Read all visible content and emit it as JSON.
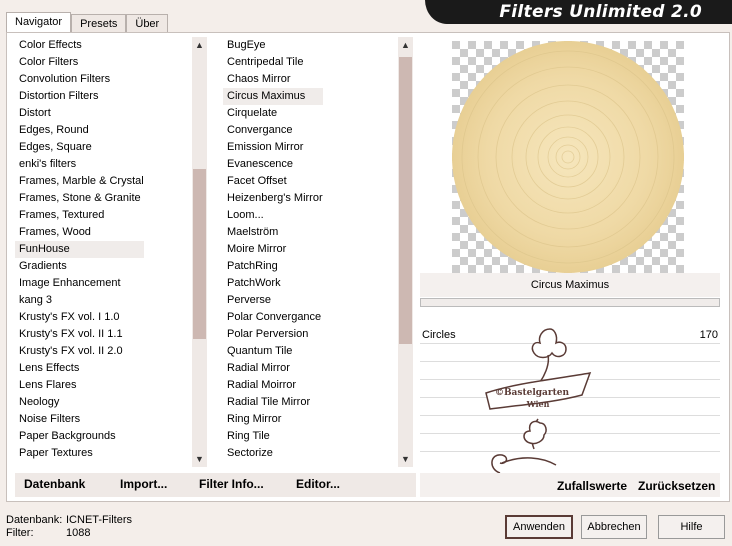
{
  "tabs": [
    "Navigator",
    "Presets",
    "Über"
  ],
  "brand": "Filters Unlimited 2.0",
  "categories": [
    "Color Effects",
    "Color Filters",
    "Convolution Filters",
    "Distortion Filters",
    "Distort",
    "Edges, Round",
    "Edges, Square",
    "enki's filters",
    "Frames, Marble & Crystal",
    "Frames, Stone & Granite",
    "Frames, Textured",
    "Frames, Wood",
    "FunHouse",
    "Gradients",
    "Image Enhancement",
    "kang 3",
    "Krusty's FX vol. I 1.0",
    "Krusty's FX vol. II 1.1",
    "Krusty's FX vol. II 2.0",
    "Lens Effects",
    "Lens Flares",
    "Neology",
    "Noise Filters",
    "Paper Backgrounds",
    "Paper Textures"
  ],
  "categories_selected": "FunHouse",
  "filters": [
    "BugEye",
    "Centripedal Tile",
    "Chaos Mirror",
    "Circus Maximus",
    "Cirquelate",
    "Convergance",
    "Emission Mirror",
    "Evanescence",
    "Facet Offset",
    "Heizenberg's Mirror",
    "Loom...",
    "Maelström",
    "Moire Mirror",
    "PatchRing",
    "PatchWork",
    "Perverse",
    "Polar Convergance",
    "Polar Perversion",
    "Quantum Tile",
    "Radial Mirror",
    "Radial Moirror",
    "Radial Tile Mirror",
    "Ring Mirror",
    "Ring Tile",
    "Sectorize"
  ],
  "filters_selected": "Circus Maximus",
  "bottom_buttons": {
    "database": "Datenbank",
    "import": "Import...",
    "filter_info": "Filter Info...",
    "editor": "Editor..."
  },
  "preview_filter_name": "Circus Maximus",
  "param": {
    "label": "Circles",
    "value": "170"
  },
  "watermark_text": [
    "©Bastelgarten",
    "Wien"
  ],
  "right_buttons": {
    "random": "Zufallswerte",
    "reset": "Zurücksetzen"
  },
  "status": {
    "db_label": "Datenbank:",
    "db_value": "ICNET-Filters",
    "filter_label": "Filter:",
    "filter_value": "1088"
  },
  "dialog_buttons": {
    "apply": "Anwenden",
    "cancel": "Abbrechen",
    "help": "Hilfe"
  },
  "colors": {
    "accent": "#5a3b36",
    "thumb": "#cdb8b2",
    "preview_fill": "#f0dcaa"
  }
}
